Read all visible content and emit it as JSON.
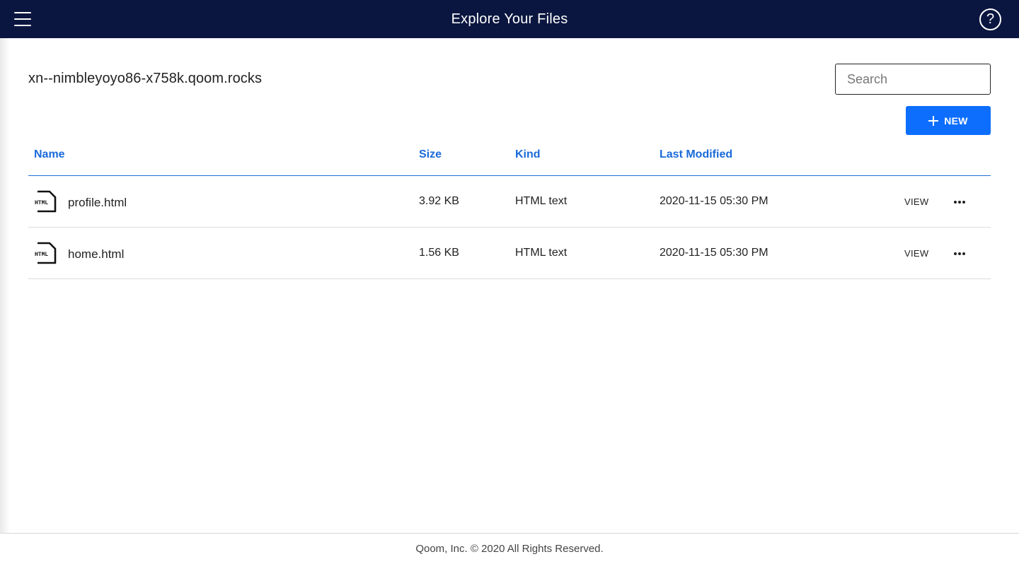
{
  "header": {
    "title": "Explore Your Files",
    "menu_icon": "hamburger-menu-icon",
    "help_icon": "question-mark-icon",
    "help_glyph": "?",
    "background_color": "#0b1640"
  },
  "main": {
    "domain": "xn--nimbleyoyo86-x758k.qoom.rocks",
    "search": {
      "placeholder": "Search",
      "value": ""
    },
    "new_button": {
      "label": "NEW",
      "icon": "plus-icon",
      "color": "#0d6efd"
    }
  },
  "table": {
    "columns": [
      "Name",
      "Size",
      "Kind",
      "Last Modified"
    ],
    "header_color": "#1a6ad9",
    "rows": [
      {
        "icon": "html-file-icon",
        "name": "profile.html",
        "size": "3.92 KB",
        "kind": "HTML text",
        "modified": "2020-11-15 05:30 PM",
        "action": "VIEW",
        "more_icon": "more-options-icon"
      },
      {
        "icon": "html-file-icon",
        "name": "home.html",
        "size": "1.56 KB",
        "kind": "HTML text",
        "modified": "2020-11-15 05:30 PM",
        "action": "VIEW",
        "more_icon": "more-options-icon"
      }
    ]
  },
  "footer": {
    "text": "Qoom, Inc. © 2020 All Rights Reserved."
  }
}
